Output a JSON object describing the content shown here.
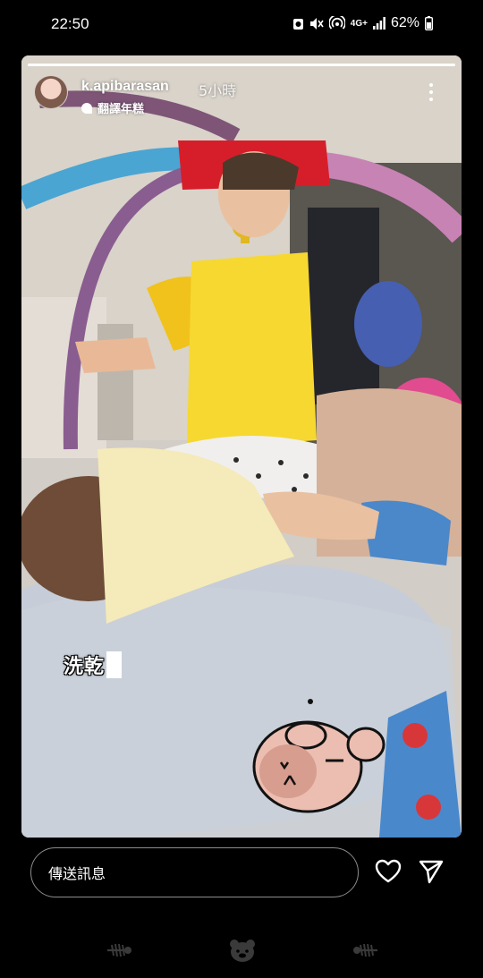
{
  "status_bar": {
    "time": "22:50",
    "network": "4G+",
    "battery": "62%"
  },
  "story": {
    "username": "k.apibarasan",
    "time_ago": "5小時",
    "audio_label": "翻譯年糕",
    "caption": "洗乾"
  },
  "reply": {
    "placeholder": "傳送訊息"
  },
  "icons": {
    "more": "more-options-icon",
    "like": "heart-icon",
    "share": "send-icon"
  },
  "colors": {
    "background": "#000000",
    "text": "#ffffff"
  }
}
